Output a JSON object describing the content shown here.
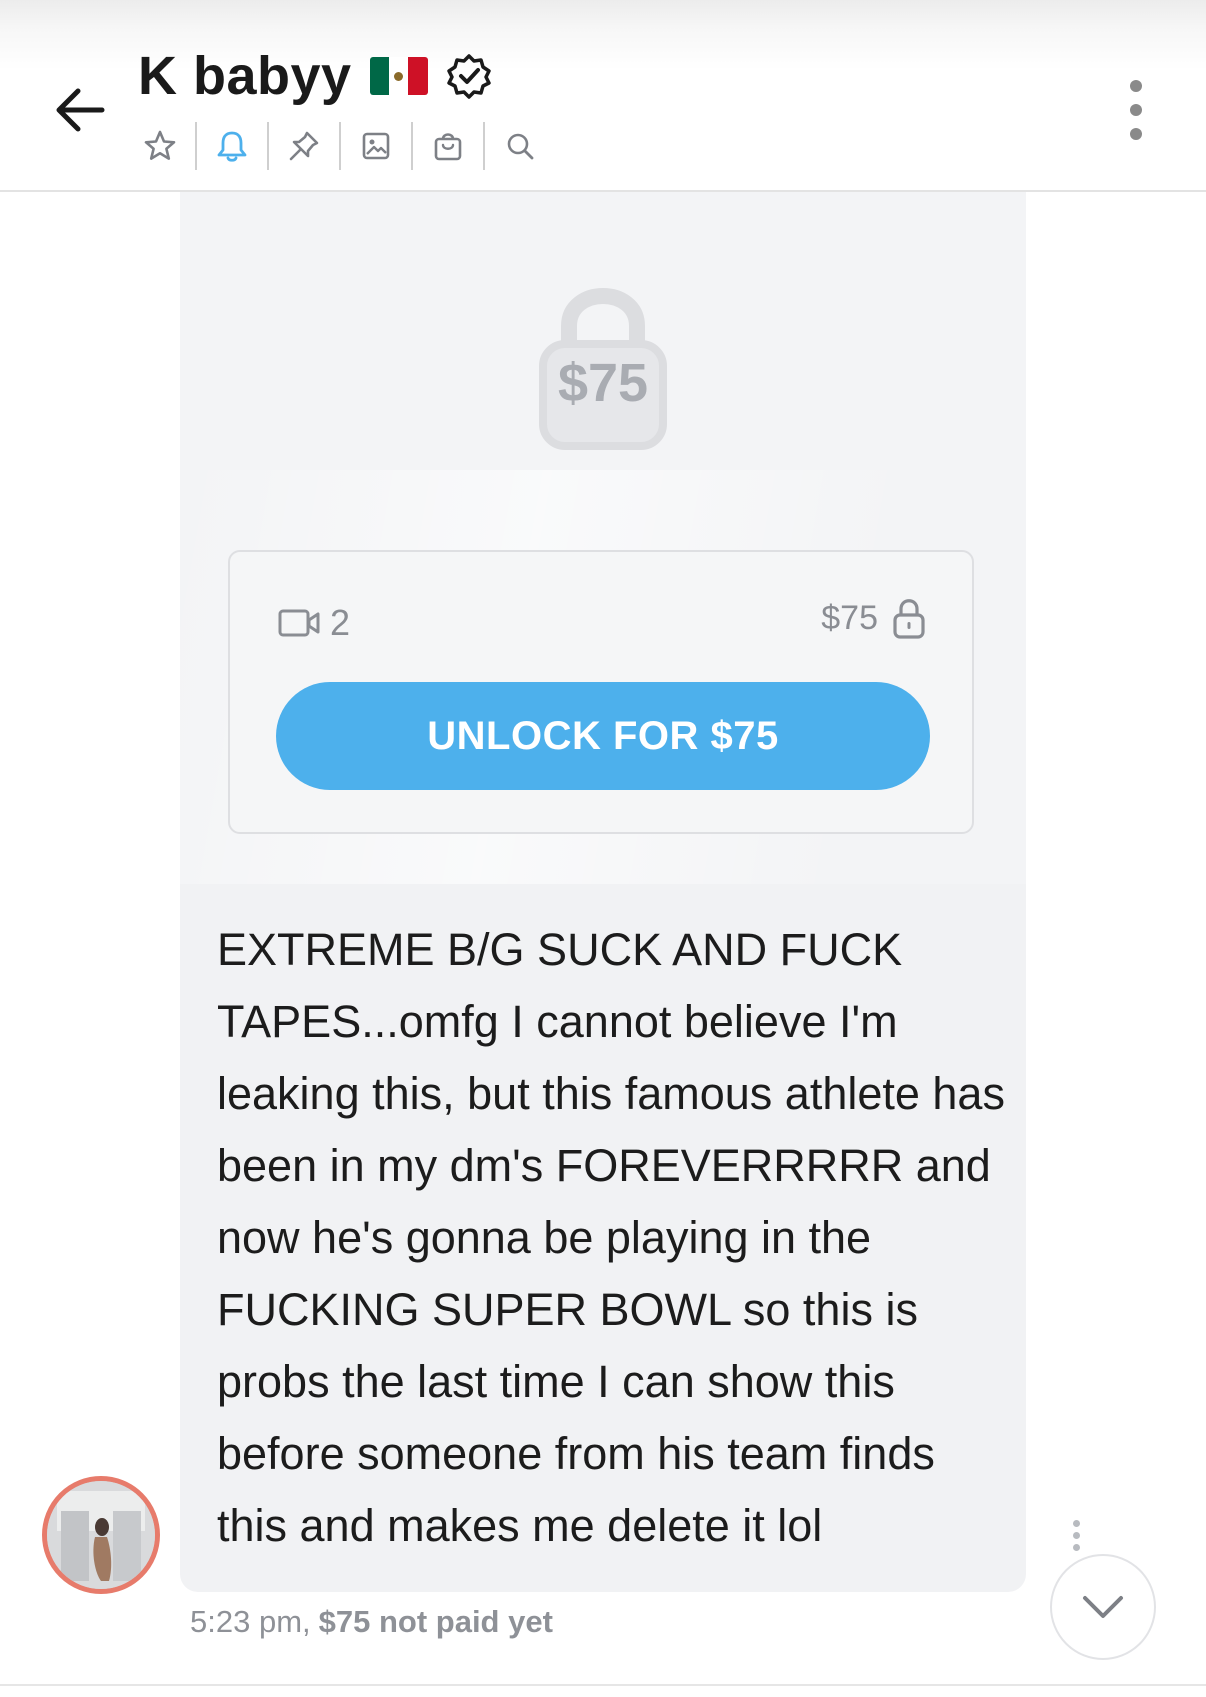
{
  "header": {
    "title": "K babyy",
    "flag_colors": [
      "#006847",
      "#ffffff",
      "#ce1126"
    ],
    "icons": {
      "back": "arrow-left-icon",
      "verified": "verified-badge-icon",
      "menu": "more-vertical-icon"
    },
    "toolbar": [
      {
        "name": "star-icon",
        "active": false
      },
      {
        "name": "bell-icon",
        "active": true
      },
      {
        "name": "pin-icon",
        "active": false
      },
      {
        "name": "image-icon",
        "active": false
      },
      {
        "name": "bag-icon",
        "active": false
      },
      {
        "name": "search-icon",
        "active": false
      }
    ],
    "accent": "#4db0ec"
  },
  "message": {
    "locked_price": "$75",
    "media_count": "2",
    "card_price": "$75",
    "unlock_label": "UNLOCK FOR $75",
    "text": "EXTREME B/G SUCK AND FUCK TAPES...omfg I cannot believe I'm leaking this, but this famous athlete has been in my dm's FOREVERRRRR and now he's gonna be playing in the FUCKING SUPER BOWL so this is probs the last time I can show this before someone from his team finds this and makes me delete it lol",
    "time": "5:23 pm,",
    "payment_status": "$75 not paid yet"
  },
  "colors": {
    "button": "#4db0ec",
    "bubble": "#f1f2f4",
    "avatar_ring": "#e77b6b"
  }
}
